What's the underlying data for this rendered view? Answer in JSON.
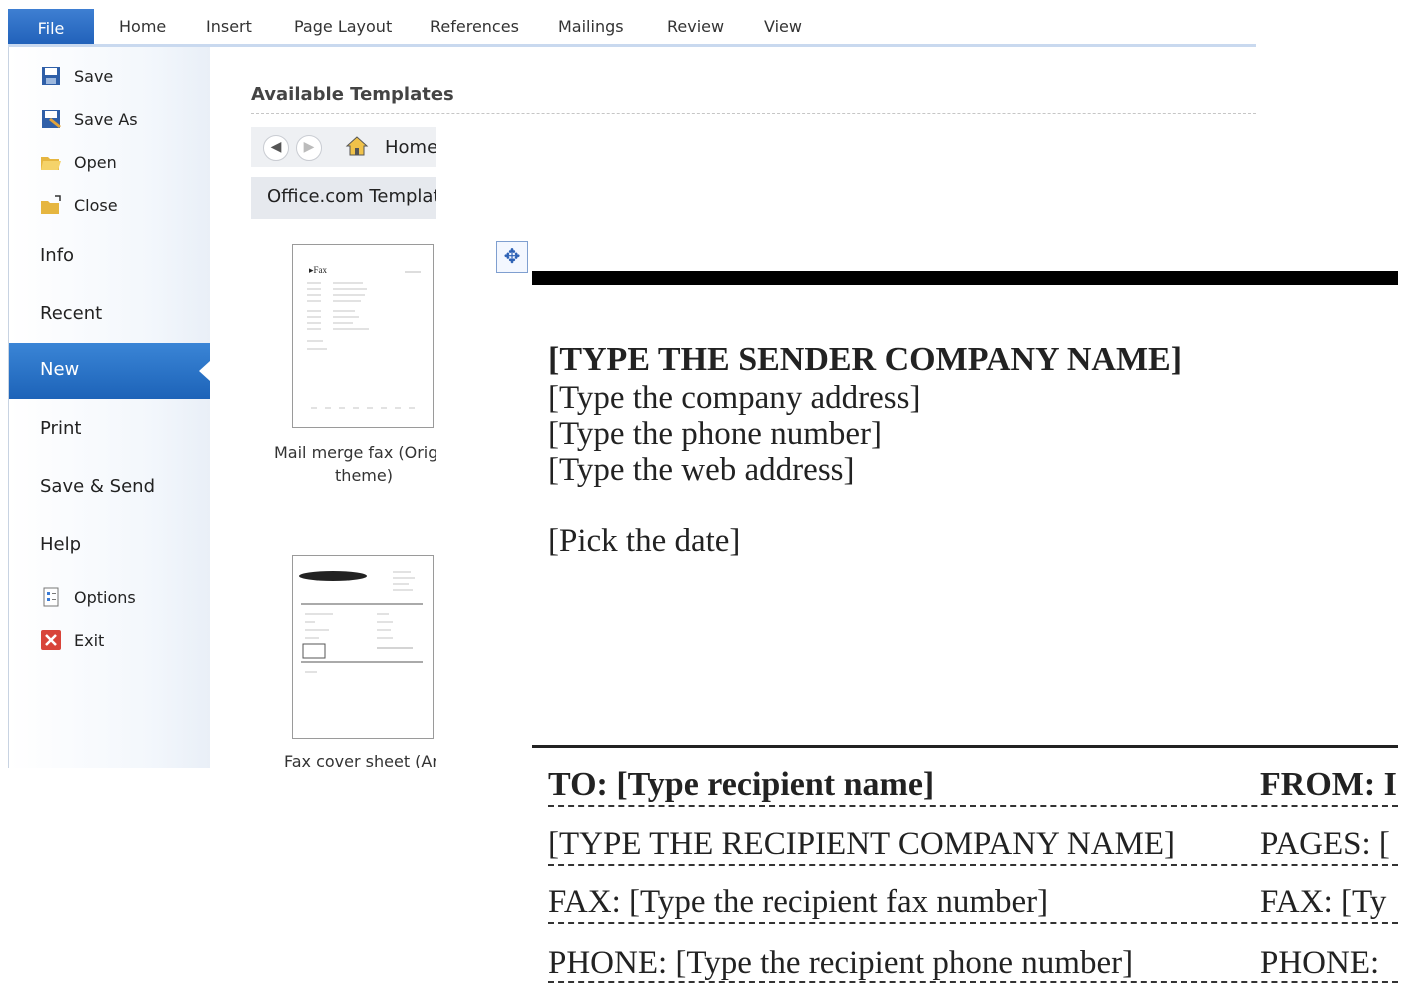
{
  "ribbon": {
    "file_tab": "File",
    "tabs": [
      "Home",
      "Insert",
      "Page Layout",
      "References",
      "Mailings",
      "Review",
      "View"
    ]
  },
  "sidebar": {
    "save": "Save",
    "save_as": "Save As",
    "open": "Open",
    "close": "Close",
    "info": "Info",
    "recent": "Recent",
    "new": "New",
    "print": "Print",
    "save_send": "Save & Send",
    "help": "Help",
    "options": "Options",
    "exit": "Exit"
  },
  "templates": {
    "heading": "Available Templates",
    "home_label": "Home",
    "office_label": "Office.com Templat",
    "item1_caption_line1": "Mail merge fax (Orig",
    "item1_caption_line2": "theme)",
    "item2_caption": "Fax cover sheet (Ar"
  },
  "document": {
    "company": "[TYPE THE SENDER COMPANY NAME]",
    "address": "[Type the company address]",
    "phone": "[Type the phone number]",
    "web": "[Type the web address]",
    "date": "[Pick the date]",
    "to": "TO: [Type recipient name]",
    "from": "FROM: I",
    "recipient_company": "[TYPE THE RECIPIENT COMPANY NAME]",
    "pages": "PAGES: [",
    "fax_left": "FAX: [Type the recipient fax number]",
    "fax_right": "FAX: [Ty",
    "phone_left": "PHONE: [Type the recipient phone number]",
    "phone_right": "PHONE:"
  },
  "colors": {
    "accent": "#1f5fb8",
    "sidebar_selected": "#2b73c8"
  }
}
